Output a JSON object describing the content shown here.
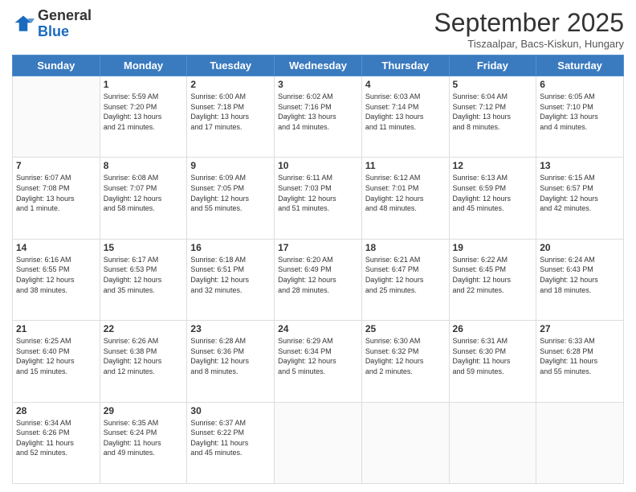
{
  "logo": {
    "general": "General",
    "blue": "Blue"
  },
  "header": {
    "month": "September 2025",
    "location": "Tiszaalpar, Bacs-Kiskun, Hungary"
  },
  "days": [
    "Sunday",
    "Monday",
    "Tuesday",
    "Wednesday",
    "Thursday",
    "Friday",
    "Saturday"
  ],
  "weeks": [
    [
      {
        "date": "",
        "info": ""
      },
      {
        "date": "1",
        "info": "Sunrise: 5:59 AM\nSunset: 7:20 PM\nDaylight: 13 hours\nand 21 minutes."
      },
      {
        "date": "2",
        "info": "Sunrise: 6:00 AM\nSunset: 7:18 PM\nDaylight: 13 hours\nand 17 minutes."
      },
      {
        "date": "3",
        "info": "Sunrise: 6:02 AM\nSunset: 7:16 PM\nDaylight: 13 hours\nand 14 minutes."
      },
      {
        "date": "4",
        "info": "Sunrise: 6:03 AM\nSunset: 7:14 PM\nDaylight: 13 hours\nand 11 minutes."
      },
      {
        "date": "5",
        "info": "Sunrise: 6:04 AM\nSunset: 7:12 PM\nDaylight: 13 hours\nand 8 minutes."
      },
      {
        "date": "6",
        "info": "Sunrise: 6:05 AM\nSunset: 7:10 PM\nDaylight: 13 hours\nand 4 minutes."
      }
    ],
    [
      {
        "date": "7",
        "info": "Sunrise: 6:07 AM\nSunset: 7:08 PM\nDaylight: 13 hours\nand 1 minute."
      },
      {
        "date": "8",
        "info": "Sunrise: 6:08 AM\nSunset: 7:07 PM\nDaylight: 12 hours\nand 58 minutes."
      },
      {
        "date": "9",
        "info": "Sunrise: 6:09 AM\nSunset: 7:05 PM\nDaylight: 12 hours\nand 55 minutes."
      },
      {
        "date": "10",
        "info": "Sunrise: 6:11 AM\nSunset: 7:03 PM\nDaylight: 12 hours\nand 51 minutes."
      },
      {
        "date": "11",
        "info": "Sunrise: 6:12 AM\nSunset: 7:01 PM\nDaylight: 12 hours\nand 48 minutes."
      },
      {
        "date": "12",
        "info": "Sunrise: 6:13 AM\nSunset: 6:59 PM\nDaylight: 12 hours\nand 45 minutes."
      },
      {
        "date": "13",
        "info": "Sunrise: 6:15 AM\nSunset: 6:57 PM\nDaylight: 12 hours\nand 42 minutes."
      }
    ],
    [
      {
        "date": "14",
        "info": "Sunrise: 6:16 AM\nSunset: 6:55 PM\nDaylight: 12 hours\nand 38 minutes."
      },
      {
        "date": "15",
        "info": "Sunrise: 6:17 AM\nSunset: 6:53 PM\nDaylight: 12 hours\nand 35 minutes."
      },
      {
        "date": "16",
        "info": "Sunrise: 6:18 AM\nSunset: 6:51 PM\nDaylight: 12 hours\nand 32 minutes."
      },
      {
        "date": "17",
        "info": "Sunrise: 6:20 AM\nSunset: 6:49 PM\nDaylight: 12 hours\nand 28 minutes."
      },
      {
        "date": "18",
        "info": "Sunrise: 6:21 AM\nSunset: 6:47 PM\nDaylight: 12 hours\nand 25 minutes."
      },
      {
        "date": "19",
        "info": "Sunrise: 6:22 AM\nSunset: 6:45 PM\nDaylight: 12 hours\nand 22 minutes."
      },
      {
        "date": "20",
        "info": "Sunrise: 6:24 AM\nSunset: 6:43 PM\nDaylight: 12 hours\nand 18 minutes."
      }
    ],
    [
      {
        "date": "21",
        "info": "Sunrise: 6:25 AM\nSunset: 6:40 PM\nDaylight: 12 hours\nand 15 minutes."
      },
      {
        "date": "22",
        "info": "Sunrise: 6:26 AM\nSunset: 6:38 PM\nDaylight: 12 hours\nand 12 minutes."
      },
      {
        "date": "23",
        "info": "Sunrise: 6:28 AM\nSunset: 6:36 PM\nDaylight: 12 hours\nand 8 minutes."
      },
      {
        "date": "24",
        "info": "Sunrise: 6:29 AM\nSunset: 6:34 PM\nDaylight: 12 hours\nand 5 minutes."
      },
      {
        "date": "25",
        "info": "Sunrise: 6:30 AM\nSunset: 6:32 PM\nDaylight: 12 hours\nand 2 minutes."
      },
      {
        "date": "26",
        "info": "Sunrise: 6:31 AM\nSunset: 6:30 PM\nDaylight: 11 hours\nand 59 minutes."
      },
      {
        "date": "27",
        "info": "Sunrise: 6:33 AM\nSunset: 6:28 PM\nDaylight: 11 hours\nand 55 minutes."
      }
    ],
    [
      {
        "date": "28",
        "info": "Sunrise: 6:34 AM\nSunset: 6:26 PM\nDaylight: 11 hours\nand 52 minutes."
      },
      {
        "date": "29",
        "info": "Sunrise: 6:35 AM\nSunset: 6:24 PM\nDaylight: 11 hours\nand 49 minutes."
      },
      {
        "date": "30",
        "info": "Sunrise: 6:37 AM\nSunset: 6:22 PM\nDaylight: 11 hours\nand 45 minutes."
      },
      {
        "date": "",
        "info": ""
      },
      {
        "date": "",
        "info": ""
      },
      {
        "date": "",
        "info": ""
      },
      {
        "date": "",
        "info": ""
      }
    ]
  ]
}
